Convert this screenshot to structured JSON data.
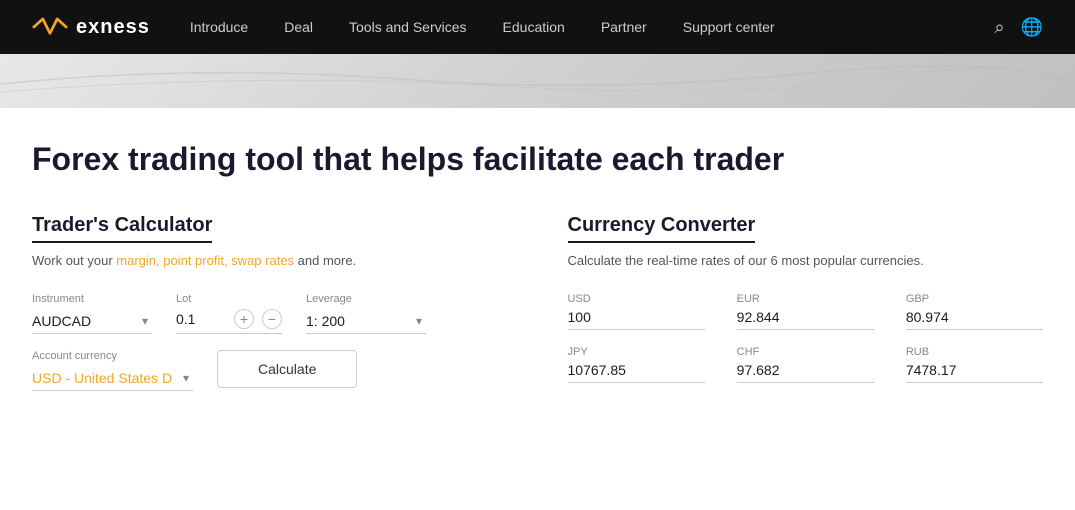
{
  "nav": {
    "logo_text": "exness",
    "links": [
      {
        "label": "Introduce",
        "id": "introduce"
      },
      {
        "label": "Deal",
        "id": "deal"
      },
      {
        "label": "Tools and Services",
        "id": "tools-and-services"
      },
      {
        "label": "Education",
        "id": "education"
      },
      {
        "label": "Partner",
        "id": "partner"
      },
      {
        "label": "Support center",
        "id": "support-center"
      }
    ]
  },
  "page": {
    "headline": "Forex trading tool that helps facilitate each trader"
  },
  "calculator": {
    "title": "Trader's Calculator",
    "description": "Work out your margin, point profit, swap rates and more.",
    "instrument_label": "Instrument",
    "instrument_value": "AUDCAD",
    "lot_label": "Lot",
    "lot_value": "0.1",
    "leverage_label": "Leverage",
    "leverage_value": "1: 200",
    "account_currency_label": "Account currency",
    "account_currency_value": "USD - United States D",
    "calculate_btn": "Calculate"
  },
  "converter": {
    "title": "Currency Converter",
    "description": "Calculate the real-time rates of our 6 most popular currencies.",
    "fields": [
      {
        "label": "USD",
        "value": "100",
        "id": "usd"
      },
      {
        "label": "EUR",
        "value": "92.844",
        "id": "eur"
      },
      {
        "label": "GBP",
        "value": "80.974",
        "id": "gbp"
      },
      {
        "label": "JPY",
        "value": "10767.85",
        "id": "jpy"
      },
      {
        "label": "CHF",
        "value": "97.682",
        "id": "chf"
      },
      {
        "label": "RUB",
        "value": "7478.17",
        "id": "rub"
      }
    ]
  }
}
